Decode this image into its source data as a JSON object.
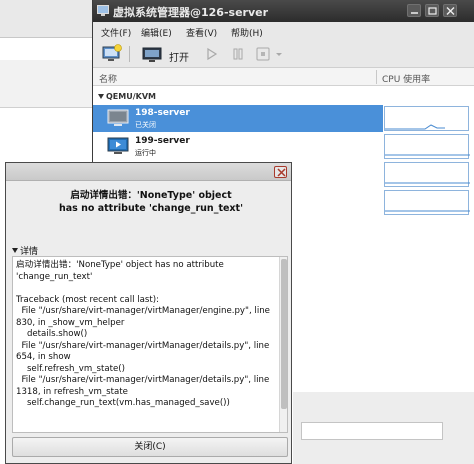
{
  "window": {
    "title": "虚拟系统管理器@126-server"
  },
  "menubar": [
    "文件(F)",
    "编辑(E)",
    "查看(V)",
    "帮助(H)"
  ],
  "toolbar": {
    "open_label": "打开"
  },
  "vm_list": {
    "col_name": "名称",
    "col_cpu": "CPU 使用率",
    "group": "QEMU/KVM",
    "rows": [
      {
        "name": "198-server",
        "status": "已关闭",
        "selected": true,
        "icon": "vm-shutoff-icon"
      },
      {
        "name": "199-server",
        "status": "运行中",
        "selected": false,
        "icon": "vm-running-icon"
      },
      {
        "name": "",
        "status": "",
        "selected": false,
        "icon": "vm-running-icon"
      }
    ]
  },
  "dialog": {
    "heading": "启动详情出错：'NoneType' object\nhas no attribute 'change_run_text'",
    "details_label": "详情",
    "details_text": "启动详情出错：'NoneType' object has no attribute 'change_run_text'\n\nTraceback (most recent call last):\n  File \"/usr/share/virt-manager/virtManager/engine.py\", line 830, in _show_vm_helper\n    details.show()\n  File \"/usr/share/virt-manager/virtManager/details.py\", line 654, in show\n    self.refresh_vm_state()\n  File \"/usr/share/virt-manager/virtManager/details.py\", line 1318, in refresh_vm_state\n    self.change_run_text(vm.has_managed_save())",
    "close_label": "关闭(C)"
  },
  "colors": {
    "selection": "#4a90d9",
    "titlebar": "#2c2c2c",
    "close_border": "#a83a2c"
  }
}
